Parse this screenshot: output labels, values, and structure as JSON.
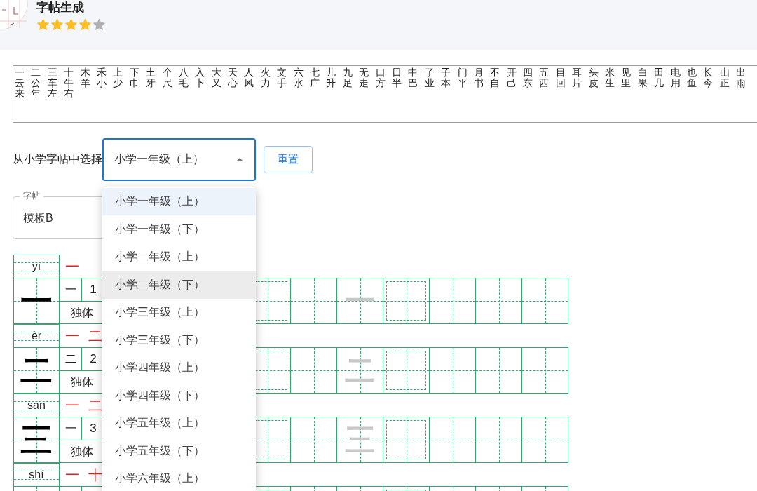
{
  "app": {
    "title": "字帖生成",
    "stars": 4
  },
  "characters_field": {
    "lines": [
      "一 二 三 十 木 禾 上 下 土 个 八 入 大 天 人 火 文 六 七 儿 九 无 口 日 中 了 子 门 月 不 开 四 五 目 耳 头 米 见 白 田 电 也 长 山 出",
      "云 公 车 牛 羊 小 少 巾 牙 尺 毛 卜 又 心 风 力 手 水 广 升 足 走 方 半 巴 业 本 平 书 自 己 东 西 回 片 皮 生 里 果 几 用 鱼 今 正 雨",
      "来 年 左 右"
    ]
  },
  "grade_select": {
    "label": "从小学字帖中选择",
    "value": "小学一年级（上）",
    "expanded": true,
    "options": [
      {
        "label": "小学一年级（上）",
        "selected": true,
        "hovered": false
      },
      {
        "label": "小学一年级（下）",
        "selected": false,
        "hovered": false
      },
      {
        "label": "小学二年级（上）",
        "selected": false,
        "hovered": false
      },
      {
        "label": "小学二年级（下）",
        "selected": false,
        "hovered": true
      },
      {
        "label": "小学三年级（上）",
        "selected": false,
        "hovered": false
      },
      {
        "label": "小学三年级（下）",
        "selected": false,
        "hovered": false
      },
      {
        "label": "小学四年级（上）",
        "selected": false,
        "hovered": false
      },
      {
        "label": "小学四年级（下）",
        "selected": false,
        "hovered": false
      },
      {
        "label": "小学五年级（上）",
        "selected": false,
        "hovered": false
      },
      {
        "label": "小学五年级（下）",
        "selected": false,
        "hovered": false
      },
      {
        "label": "小学六年级（上）",
        "selected": false,
        "hovered": false
      }
    ]
  },
  "reset_button": "重置",
  "template_field": {
    "label": "字帖",
    "value": "模板B"
  },
  "worksheet": [
    {
      "pinyin": "yī",
      "strokes": [
        "一"
      ],
      "char": "一",
      "radical": "一",
      "stroke_count": "1",
      "structure": "独体",
      "trace": "一"
    },
    {
      "pinyin": "èr",
      "strokes": [
        "一",
        "二"
      ],
      "char": "二",
      "radical": "二",
      "stroke_count": "2",
      "structure": "独体",
      "trace": "二"
    },
    {
      "pinyin": "sān",
      "strokes": [
        "一",
        "二"
      ],
      "char": "三",
      "radical": "一",
      "stroke_count": "3",
      "structure": "独体",
      "trace": "三"
    },
    {
      "pinyin": "shí",
      "strokes": [
        "一",
        "十"
      ]
    }
  ]
}
